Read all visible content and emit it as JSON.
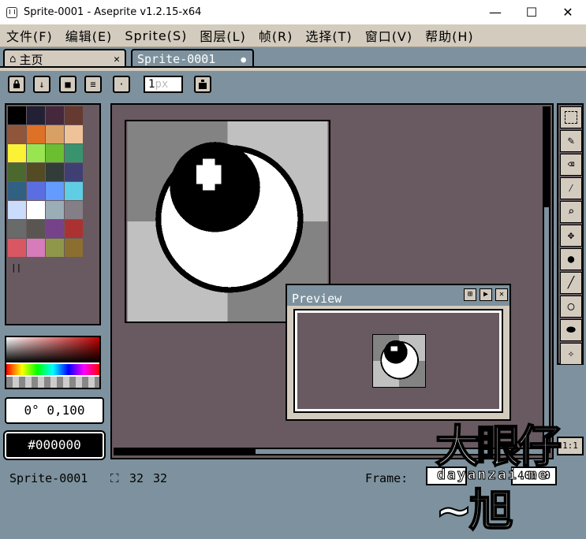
{
  "window": {
    "title": "Sprite-0001 - Aseprite v1.2.15-x64",
    "minimize": "—",
    "maximize": "☐",
    "close": "✕"
  },
  "menu": [
    "文件(F)",
    "编辑(E)",
    "Sprite(S)",
    "图层(L)",
    "帧(R)",
    "选择(T)",
    "窗口(V)",
    "帮助(H)"
  ],
  "tabs": [
    {
      "label": "主页",
      "icon": "home-icon",
      "close": "✕"
    },
    {
      "label": "Sprite-0001",
      "icon": "modified-dot-icon",
      "dot": "●"
    }
  ],
  "toolbar": {
    "buttons": [
      {
        "icon": "lock-icon",
        "glyph": "🔒"
      },
      {
        "icon": "download-icon",
        "glyph": "↓"
      },
      {
        "icon": "square-icon",
        "glyph": "■"
      },
      {
        "icon": "menu-icon",
        "glyph": "≡"
      },
      {
        "icon": "brush-dot-icon",
        "glyph": "·"
      }
    ],
    "brush_size": "1",
    "brush_size_unit": "px",
    "ink_icon": "ink-bottle-icon"
  },
  "palette": {
    "swatches": [
      "#000000",
      "#222034",
      "#45283c",
      "#663931",
      "#8f563b",
      "#df7126",
      "#d9a066",
      "#eec39a",
      "#fbf236",
      "#99e550",
      "#6abe30",
      "#37946e",
      "#4b692f",
      "#524b24",
      "#323c39",
      "#3f3f74",
      "#306082",
      "#5b6ee1",
      "#639bff",
      "#5fcde4",
      "#cbdbfc",
      "#ffffff",
      "#9badb7",
      "#847e87",
      "#696a6a",
      "#595652",
      "#76428a",
      "#ac3232",
      "#d95763",
      "#d77bba",
      "#8f974a",
      "#8a6f30"
    ],
    "selected_marker": "||"
  },
  "color": {
    "hsv_readout": "0° 0,100",
    "hex_readout": "#000000"
  },
  "preview": {
    "title": "Preview"
  },
  "status": {
    "sprite_name": "Sprite-0001",
    "size_w": "32",
    "size_h": "32",
    "frame_label": "Frame:",
    "zoom": "400.0",
    "one_to_one": "1:1"
  },
  "watermark": {
    "big": "大眼仔~旭",
    "small": "dayanzai.me"
  },
  "colors": {
    "panel": "#685a60",
    "chrome": "#7d929e",
    "button": "#d3cbbe"
  }
}
